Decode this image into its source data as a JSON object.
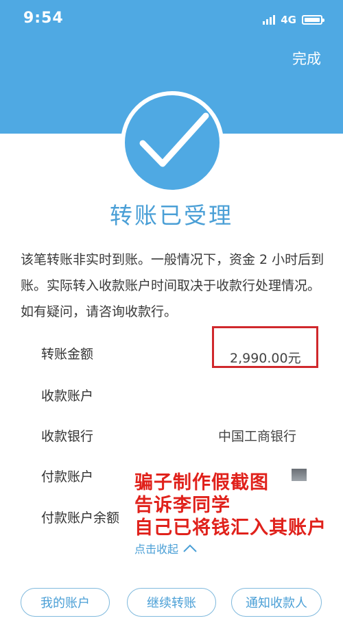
{
  "status_bar": {
    "time": "9:54",
    "network": "4G"
  },
  "header": {
    "done_label": "完成"
  },
  "title": "转账已受理",
  "notice": "该笔转账非实时到账。一般情况下，资金 2 小时后到账。实际转入收款账户时间取决于收款行处理情况。如有疑问，请咨询收款行。",
  "details": {
    "amount_label": "转账金额",
    "amount_value": "2,990.00元",
    "payee_account_label": "收款账户",
    "payee_bank_label": "收款银行",
    "payee_bank_value": "中国工商银行",
    "payer_account_label": "付款账户",
    "payer_balance_label": "付款账户余额"
  },
  "overlay": {
    "line1": "骗子制作假截图",
    "line2": "告诉李同学",
    "line3": "自己已将钱汇入其账户"
  },
  "collapse_label": "点击收起",
  "buttons": {
    "my_account": "我的账户",
    "continue_transfer": "继续转账",
    "notify_payee": "通知收款人"
  },
  "colors": {
    "accent": "#4fa9e3",
    "title": "#4a9fd6",
    "warning": "#e0211b"
  },
  "icons": {
    "check": "check-icon",
    "collapse": "chevron-up-icon"
  }
}
